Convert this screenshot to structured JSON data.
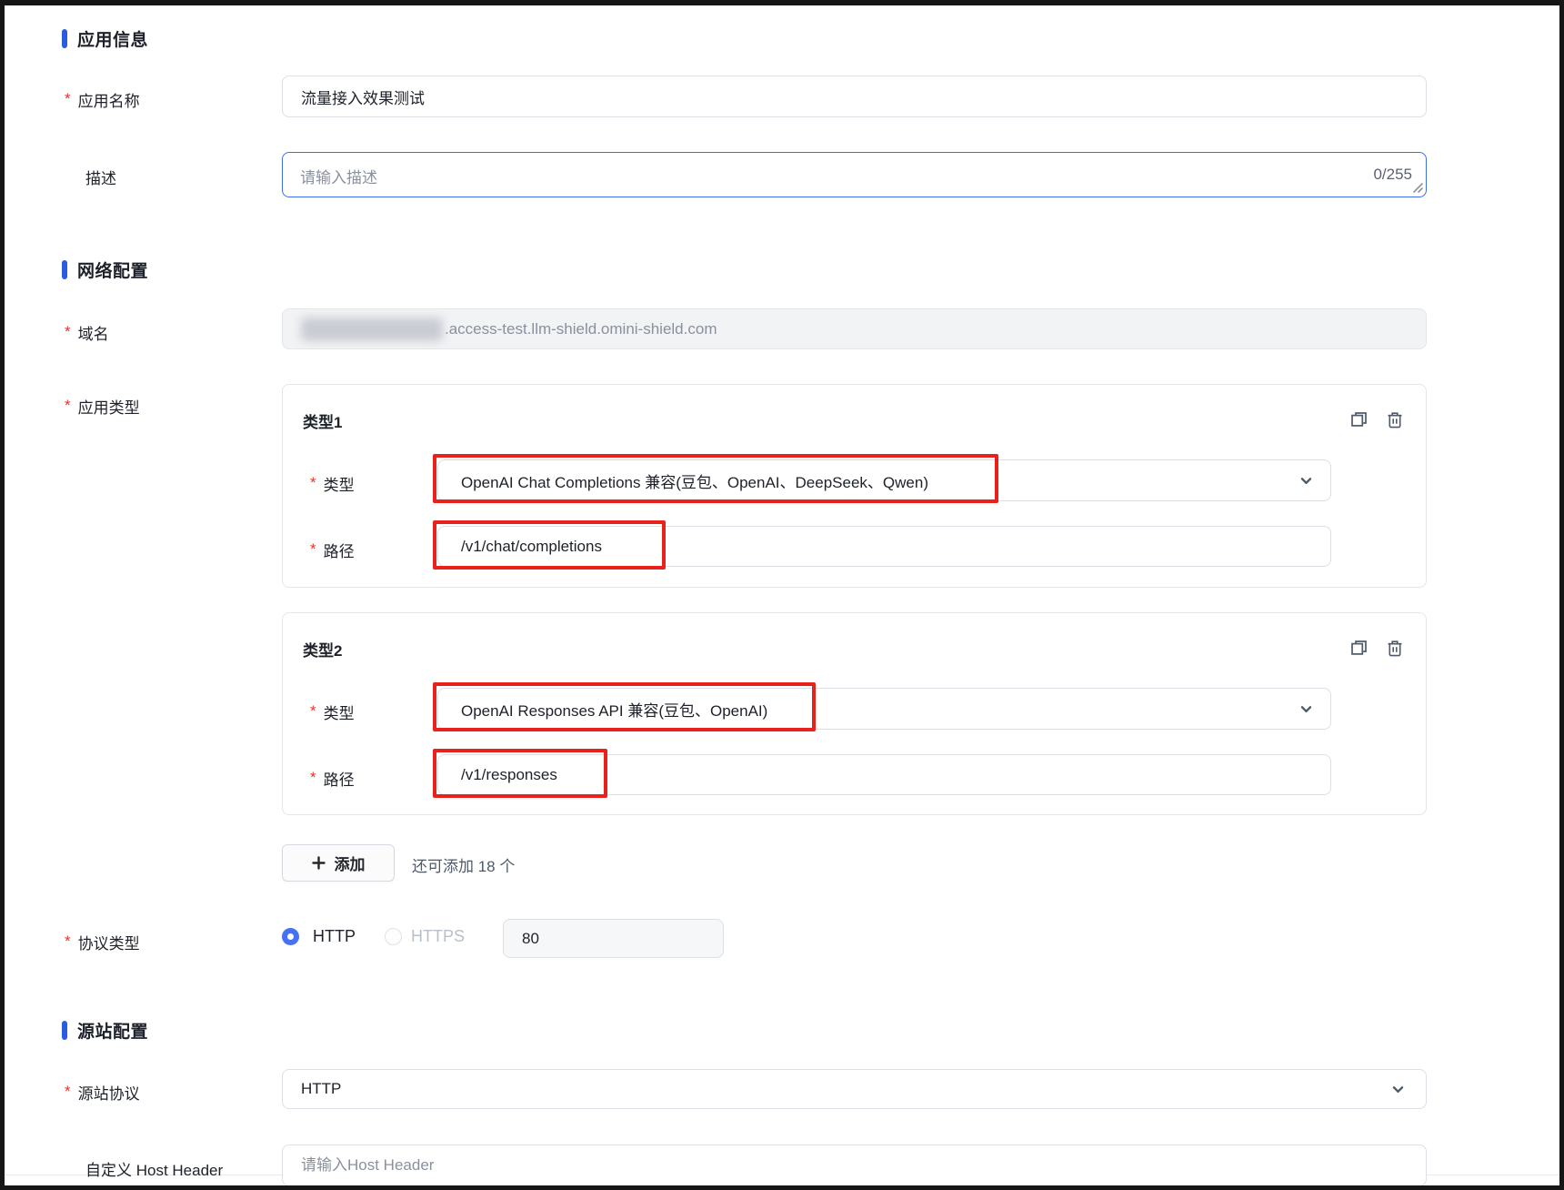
{
  "ui": {
    "required_marker": "*"
  },
  "colors": {
    "section_bar_blue": "#2b5ce0",
    "required_red": "#ec2f26",
    "annotation_red": "#e8211d",
    "focused_border_blue": "#3d6cf0",
    "radio_selected_blue": "#4471f5"
  },
  "app_info": {
    "section_title": "应用信息",
    "app_name": {
      "label": "应用名称",
      "value": "流量接入效果测试"
    },
    "description": {
      "label": "描述",
      "placeholder": "请输入描述",
      "counter": "0/255"
    }
  },
  "network": {
    "section_title": "网络配置",
    "domain": {
      "label": "域名",
      "value": ".access-test.llm-shield.omini-shield.com"
    },
    "app_type": {
      "label": "应用类型",
      "cards": [
        {
          "title": "类型1",
          "type_label": "类型",
          "type_value": "OpenAI Chat Completions 兼容(豆包、OpenAI、DeepSeek、Qwen)",
          "path_label": "路径",
          "path_value": "/v1/chat/completions"
        },
        {
          "title": "类型2",
          "type_label": "类型",
          "type_value": "OpenAI Responses API 兼容(豆包、OpenAI)",
          "path_label": "路径",
          "path_value": "/v1/responses"
        }
      ],
      "add_button": "添加",
      "add_hint": "还可添加 18 个"
    },
    "protocol": {
      "label": "协议类型",
      "options": [
        {
          "label": "HTTP",
          "selected": true
        },
        {
          "label": "HTTPS",
          "selected": false,
          "disabled": true
        }
      ],
      "port": "80"
    }
  },
  "origin": {
    "section_title": "源站配置",
    "origin_protocol": {
      "label": "源站协议",
      "value": "HTTP"
    },
    "host_header": {
      "label": "自定义 Host Header",
      "placeholder": "请输入Host Header"
    }
  }
}
